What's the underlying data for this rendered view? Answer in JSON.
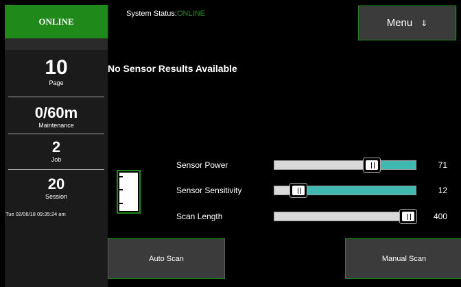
{
  "badge": {
    "label": "ONLINE"
  },
  "header": {
    "status_label": "System Status:",
    "status_value": "ONLINE",
    "menu_label": "Menu",
    "menu_icon": "⇓"
  },
  "sidebar": {
    "page": {
      "value": "10",
      "label": "Page"
    },
    "maintenance": {
      "value": "0/60m",
      "label": "Maintenance"
    },
    "job": {
      "value": "2",
      "label": "Job"
    },
    "session": {
      "value": "20",
      "label": "Session"
    },
    "timestamp": "Tue 02/06/18 09:35:24 am"
  },
  "main": {
    "message": "No Sensor Results Available",
    "gauge_icon": "level-gauge-icon",
    "sliders": [
      {
        "label": "Sensor Power",
        "value": "71",
        "percent": 0.71
      },
      {
        "label": "Sensor Sensitivity",
        "value": "12",
        "percent": 0.12
      },
      {
        "label": "Scan Length",
        "value": "400",
        "percent": 1.0
      }
    ]
  },
  "actions": {
    "auto_scan": "Auto Scan",
    "manual_scan": "Manual Scan"
  },
  "colors": {
    "accent_green": "#1f8a1a",
    "slider_fill": "#3fb8b0"
  }
}
